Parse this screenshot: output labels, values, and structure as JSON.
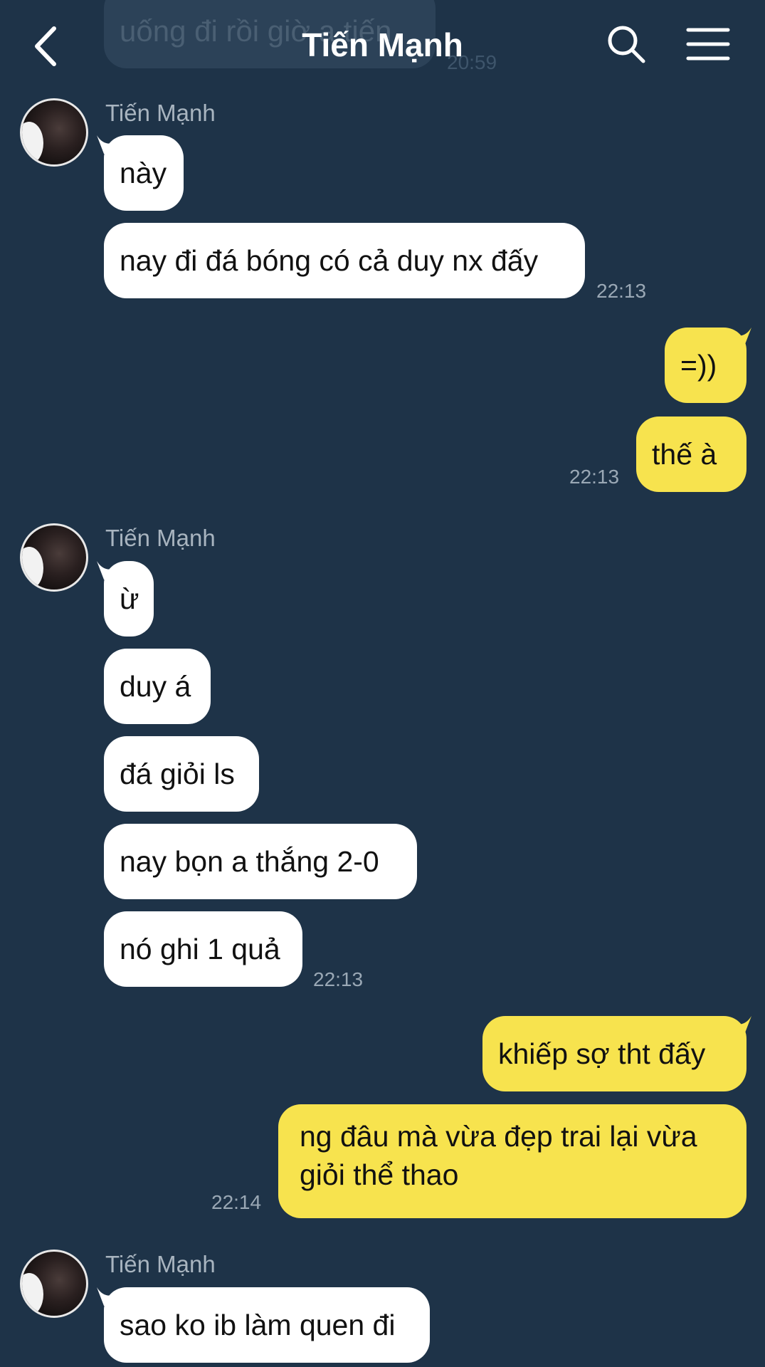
{
  "header": {
    "title": "Tiến Mạnh",
    "back_icon": "chevron-left-icon",
    "search_icon": "search-icon",
    "menu_icon": "hamburger-menu-icon"
  },
  "previous": {
    "text": "uống đi rồi giờ a tiến",
    "time": "20:59"
  },
  "colors": {
    "background": "#1e3348",
    "incoming": "#ffffff",
    "outgoing": "#f7e34e",
    "timestamp": "#9aa8b5"
  },
  "groups": [
    {
      "sender": "Tiến Mạnh",
      "messages": [
        "này",
        "nay đi đá bóng có cả duy nx đấy"
      ],
      "time": "22:13"
    },
    {
      "messages": [
        "=))",
        "thế à"
      ],
      "time": "22:13"
    },
    {
      "sender": "Tiến Mạnh",
      "messages": [
        "ừ",
        "duy á",
        "đá giỏi ls",
        "nay bọn a thắng 2-0",
        "nó ghi 1 quả"
      ],
      "time": "22:13"
    },
    {
      "messages": [
        "khiếp sợ tht đấy",
        "ng đâu mà vừa đẹp trai lại vừa giỏi thể thao"
      ],
      "time": "22:14"
    },
    {
      "sender": "Tiến Mạnh",
      "messages": [
        "sao ko ib làm quen đi"
      ]
    }
  ]
}
